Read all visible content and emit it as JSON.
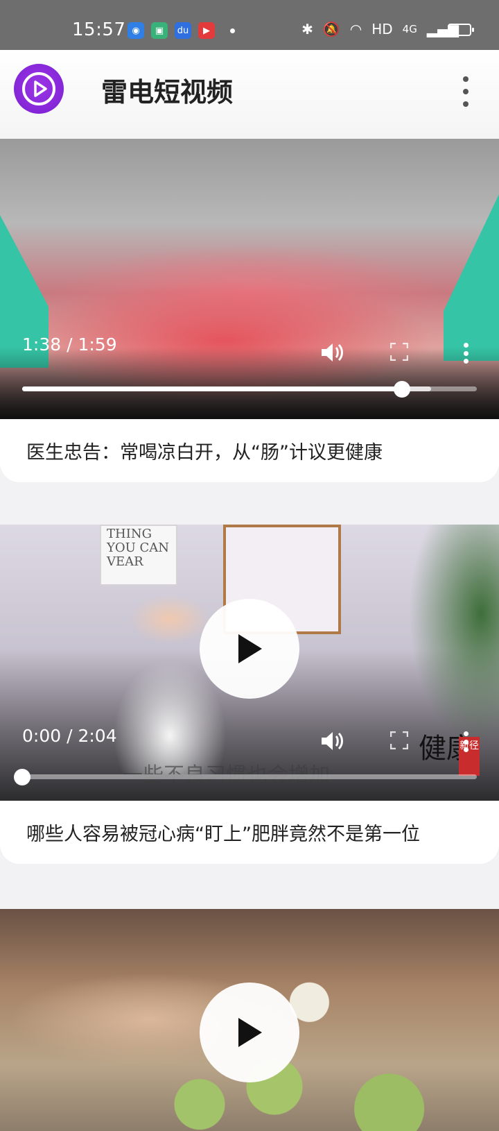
{
  "status_bar": {
    "time": "15:57",
    "network": "HD",
    "network_type": "4G",
    "battery_level": 0.2
  },
  "app": {
    "title": "雷电短视频",
    "accent_color": "#8a2be2"
  },
  "videos": [
    {
      "current_time": "1:38",
      "duration": "1:59",
      "time_text": "1:38 / 1:59",
      "progress": 0.835,
      "buffered": 0.9,
      "playing": true,
      "caption": "医生忠告：常喝凉白开，从“肠”计议更健康"
    },
    {
      "current_time": "0:00",
      "duration": "2:04",
      "time_text": "0:00 / 2:04",
      "progress": 0.0,
      "playing": false,
      "caption": "哪些人容易被冠心病“盯上”肥胖竟然不是第一位",
      "poster_text": "THING YOU CAN VEAR",
      "subtitle_overlay": "一些不良习惯也会增加",
      "watermark": "健康",
      "watermark_badge": "新径"
    },
    {
      "playing": false
    }
  ]
}
